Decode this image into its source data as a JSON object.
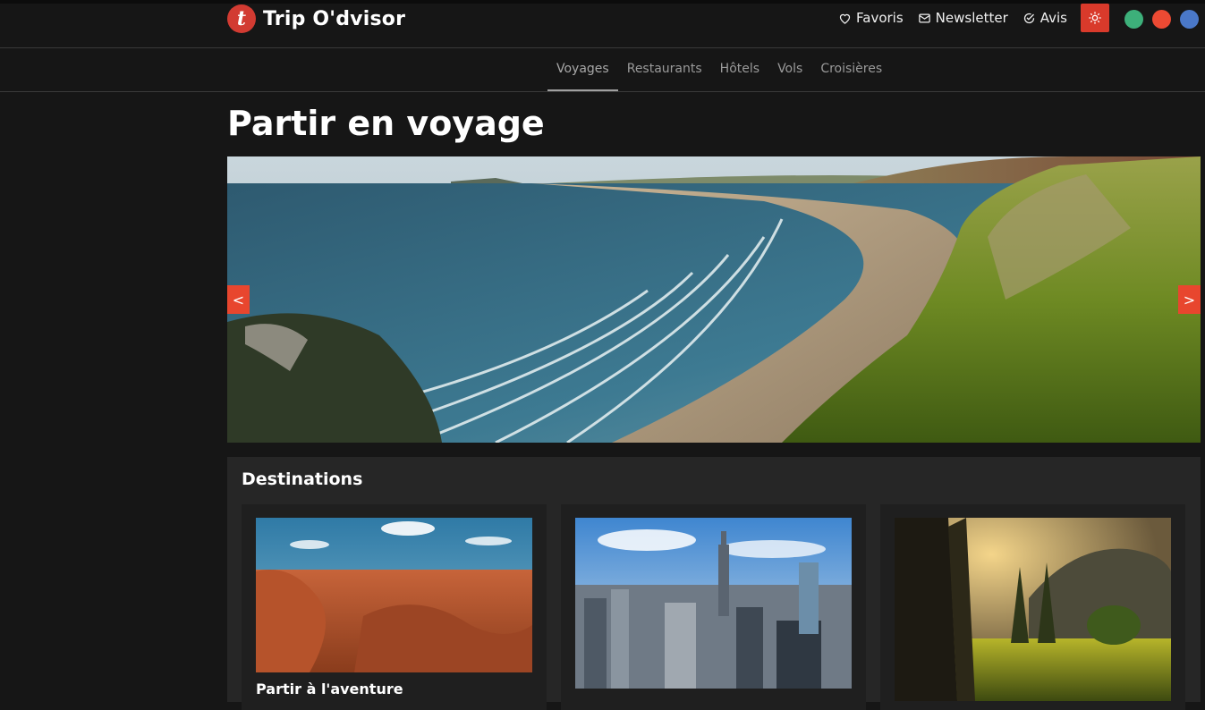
{
  "header": {
    "brand": "Trip O'dvisor",
    "logo_letter": "t",
    "links": [
      {
        "label": "Favoris",
        "icon": "heart-icon"
      },
      {
        "label": "Newsletter",
        "icon": "mail-icon"
      },
      {
        "label": "Avis",
        "icon": "check-circle-icon"
      }
    ],
    "theme_icon": "sun-icon",
    "color_dots": [
      "#3db07a",
      "#ec4a33",
      "#4a78c8"
    ],
    "accent": "#d93a2b"
  },
  "nav": {
    "tabs": [
      "Voyages",
      "Restaurants",
      "Hôtels",
      "Vols",
      "Croisières"
    ],
    "active": "Voyages"
  },
  "page": {
    "title": "Partir en voyage"
  },
  "carousel": {
    "prev": "<",
    "next": ">"
  },
  "destinations": {
    "title": "Destinations",
    "cards": [
      {
        "title": "Partir à l'aventure"
      },
      {
        "title": ""
      },
      {
        "title": ""
      }
    ]
  }
}
